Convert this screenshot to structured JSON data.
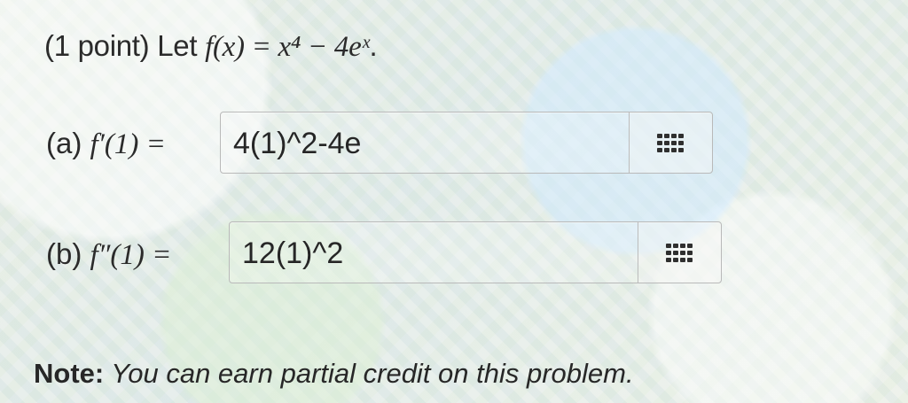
{
  "problem": {
    "prompt_prefix": "(1 point) Let ",
    "function_expression": "f(x) = x⁴ − 4eˣ",
    "prompt_suffix": ".",
    "parts": [
      {
        "label": "(a) ",
        "expression": "f′(1) = ",
        "answer_value": "4(1)^2-4e",
        "input_action_icon": "grid-icon"
      },
      {
        "label": "(b) ",
        "expression": "f″(1) = ",
        "answer_value": "12(1)^2",
        "input_action_icon": "grid-icon"
      }
    ],
    "note_label": "Note:",
    "note_text": " You can earn partial credit on this problem."
  }
}
